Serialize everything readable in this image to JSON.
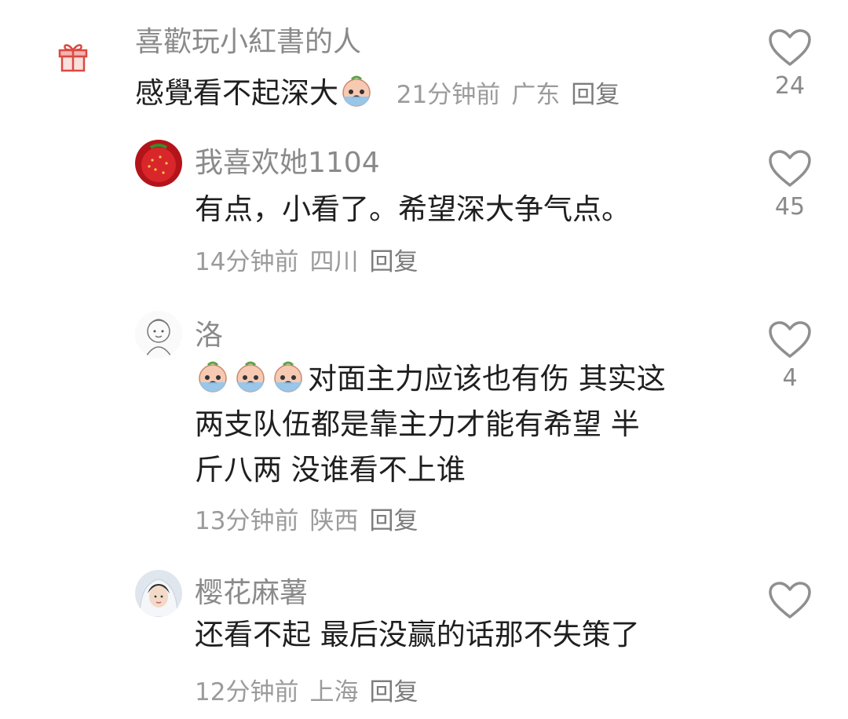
{
  "comments": [
    {
      "username": "喜歡玩小紅書的人",
      "text": "感覺看不起深大",
      "time": "21分钟前",
      "location": "广东",
      "reply": "回复",
      "likes": "24",
      "avatar": "gift-icon"
    },
    {
      "username": "我喜欢她1104",
      "text": "有点，小看了。希望深大争气点。",
      "time": "14分钟前",
      "location": "四川",
      "reply": "回复",
      "likes": "45",
      "avatar": "strawberry-avatar"
    },
    {
      "username": "洛",
      "text_lines": [
        "对面主力应该也有伤 其实这",
        "两支队伍都是靠主力才能有希望 半",
        "斤八两 没谁看不上谁"
      ],
      "time": "13分钟前",
      "location": "陕西",
      "reply": "回复",
      "likes": "4",
      "avatar": "sketch-avatar"
    },
    {
      "username": "樱花麻薯",
      "text": "还看不起 最后没赢的话那不失策了",
      "time": "12分钟前",
      "location": "上海",
      "reply": "回复",
      "likes": "",
      "avatar": "girl-avatar"
    }
  ],
  "colors": {
    "meta": "#9b9b9b",
    "username": "#8a8a8a",
    "text": "#1f1f1f"
  }
}
